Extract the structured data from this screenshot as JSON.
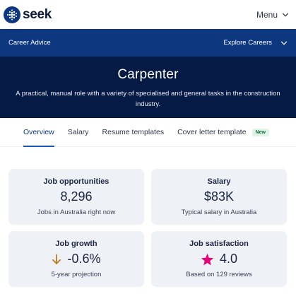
{
  "brand": {
    "name": "seek"
  },
  "topbar": {
    "menu_label": "Menu"
  },
  "nav": {
    "left_label": "Career Advice",
    "right_label": "Explore Careers"
  },
  "hero": {
    "title": "Carpenter",
    "description": "A practical, manual role with a variety of specialised and general tasks in the construction industry."
  },
  "tabs": [
    {
      "label": "Overview",
      "active": true
    },
    {
      "label": "Salary",
      "active": false
    },
    {
      "label": "Resume templates",
      "active": false
    },
    {
      "label": "Cover letter template",
      "active": false,
      "badge": "New"
    }
  ],
  "cards": {
    "job_opportunities": {
      "title": "Job opportunities",
      "value": "8,296",
      "subtitle": "Jobs in Australia right now"
    },
    "salary": {
      "title": "Salary",
      "value": "$83K",
      "subtitle": "Typical salary in Australia"
    },
    "job_growth": {
      "title": "Job growth",
      "value": "-0.6%",
      "subtitle": "5-year projection",
      "icon": "arrow-down-icon",
      "icon_color": "#c47a1e"
    },
    "job_satisfaction": {
      "title": "Job satisfaction",
      "value": "4.0",
      "subtitle": "Based on 129 reviews",
      "icon": "star-icon",
      "icon_color": "#e60278"
    }
  },
  "colors": {
    "brand_blue": "#0d3880",
    "hero_navy": "#051a45",
    "card_bg": "#eef1f6",
    "tab_underline": "#1b56b8"
  }
}
